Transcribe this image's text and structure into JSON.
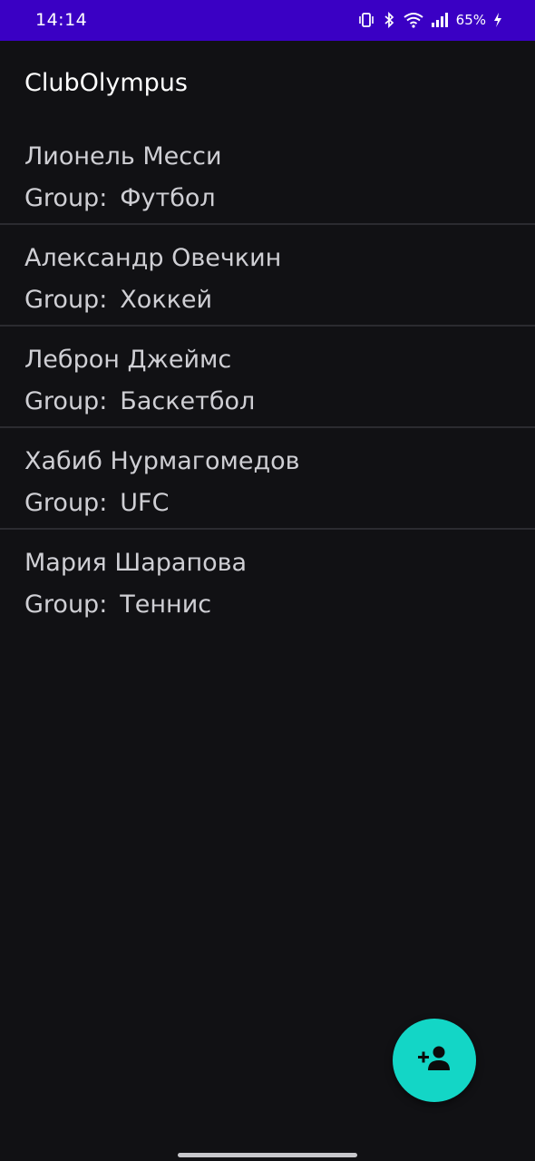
{
  "status_bar": {
    "time": "14:14",
    "battery": "65%",
    "background": "#3a00c4"
  },
  "app": {
    "title": "ClubOlympus"
  },
  "members": [
    {
      "name": "Лионель Месси",
      "group_label": "Group:",
      "group": "Футбол"
    },
    {
      "name": "Александр Овечкин",
      "group_label": "Group:",
      "group": "Хоккей"
    },
    {
      "name": "Леброн Джеймс",
      "group_label": "Group:",
      "group": "Баскетбол"
    },
    {
      "name": "Хабиб Нурмагомедов",
      "group_label": "Group:",
      "group": "UFC"
    },
    {
      "name": "Мария Шарапова",
      "group_label": "Group:",
      "group": "Теннис"
    }
  ],
  "fab": {
    "icon": "person-add-icon",
    "color": "#13d6c6"
  },
  "colors": {
    "background": "#111114",
    "text": "#cfcfd4",
    "divider": "#2b2b30"
  }
}
